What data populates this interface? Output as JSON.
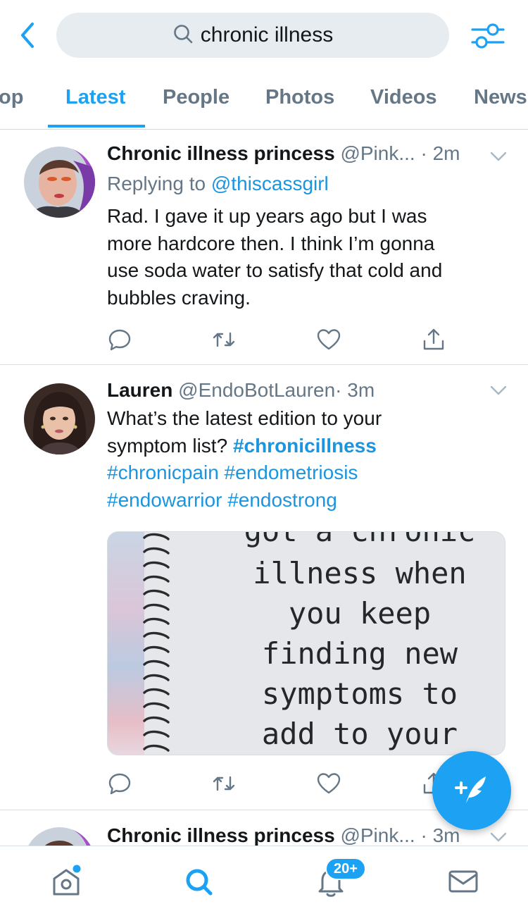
{
  "search": {
    "query": "chronic illness"
  },
  "tabs": [
    {
      "label": "op"
    },
    {
      "label": "Latest"
    },
    {
      "label": "People"
    },
    {
      "label": "Photos"
    },
    {
      "label": "Videos"
    },
    {
      "label": "News"
    }
  ],
  "tweets": [
    {
      "name": "Chronic illness princess",
      "handle": "@Pink...",
      "time": "· 2m",
      "replying_prefix": "Replying to",
      "replying_to": "@thiscassgirl",
      "text_lines": [
        "Rad. I gave it up years ago but I was",
        "more hardcore then. I think I’m gonna",
        "use soda water to satisfy that cold and",
        "bubbles craving."
      ]
    },
    {
      "name": "Lauren",
      "handle": "@EndoBotLauren",
      "time": "· 3m",
      "text_line1": "What’s the latest edition to your",
      "text_line2_plain": "symptom list?",
      "hashtag_bold": "#chronicillness",
      "hashtag_line3": "#chronicpain #endometriosis",
      "hashtag_line4": "#endowarrior #endostrong",
      "image_lines": [
        "got a chronic",
        "illness when",
        "you keep",
        "finding new",
        "symptoms to",
        "add to your"
      ]
    },
    {
      "name": "Chronic illness princess",
      "handle": "@Pink...",
      "time": "· 3m"
    }
  ],
  "notifications": {
    "badge": "20+"
  },
  "colors": {
    "accent": "#1da1f2",
    "secondary_text": "#657786",
    "link": "#1b95e0"
  },
  "icons": [
    "back-chevron",
    "search",
    "filter-sliders",
    "reply",
    "retweet",
    "like",
    "share",
    "compose",
    "home",
    "explore-search",
    "notifications-bell",
    "messages-envelope"
  ]
}
